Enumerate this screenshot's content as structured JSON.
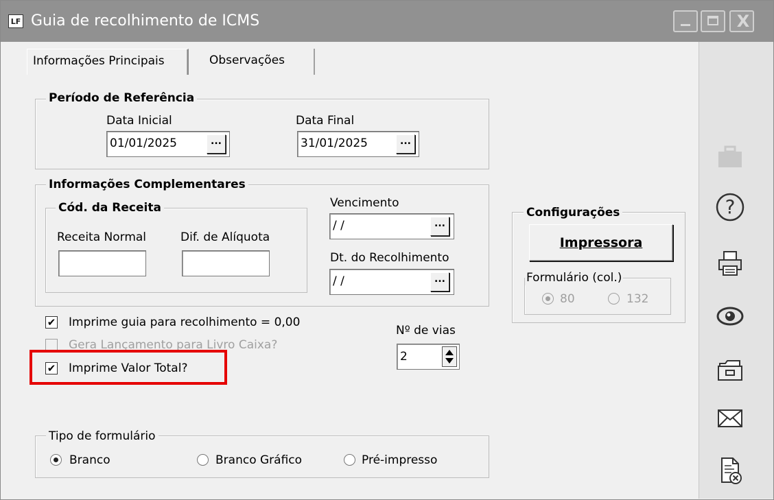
{
  "window": {
    "title": "Guia de recolhimento de ICMS",
    "app_icon_text": "LF",
    "min_glyph": "_",
    "close_glyph": "X"
  },
  "tabs": [
    {
      "label": "Informações Principais",
      "active": true
    },
    {
      "label": "Observações",
      "active": false
    }
  ],
  "periodo": {
    "legend": "Período de Referência",
    "data_inicial_label": "Data Inicial",
    "data_inicial_value": "01/01/2025",
    "data_final_label": "Data Final",
    "data_final_value": "31/01/2025",
    "dots": "..."
  },
  "complementares": {
    "legend": "Informações Complementares",
    "cod_receita_legend": "Cód. da Receita",
    "receita_normal_label": "Receita Normal",
    "receita_normal_value": "",
    "dif_aliquota_label": "Dif. de Alíquota",
    "dif_aliquota_value": "",
    "vencimento_label": "Vencimento",
    "vencimento_value": " / /",
    "dt_recolhimento_label": "Dt. do Recolhimento",
    "dt_recolhimento_value": " / /"
  },
  "options": {
    "check_mark": "✔",
    "imprime_guia_label": "Imprime guia para recolhimento = 0,00",
    "imprime_guia_checked": true,
    "gera_lancamento_label": "Gera Lançamento para Livro Caixa?",
    "gera_lancamento_checked": false,
    "imprime_valor_total_label": "Imprime Valor Total?",
    "imprime_valor_total_checked": true
  },
  "vias": {
    "label": "Nº de vias",
    "value": "2"
  },
  "configuracoes": {
    "legend": "Configurações",
    "impressora_button": "Impressora",
    "formulario_legend": "Formulário (col.)",
    "opt_80": "80",
    "opt_132": "132",
    "selected": "80"
  },
  "tipo_formulario": {
    "legend": "Tipo de formulário",
    "options": [
      "Branco",
      "Branco Gráfico",
      "Pré-impresso"
    ],
    "selected": "Branco"
  },
  "toolbar": {
    "help_glyph": "?",
    "icons": [
      "briefcase-icon",
      "help-icon",
      "printer-icon",
      "eye-icon",
      "folder-icon",
      "mail-icon",
      "document-close-icon"
    ]
  }
}
